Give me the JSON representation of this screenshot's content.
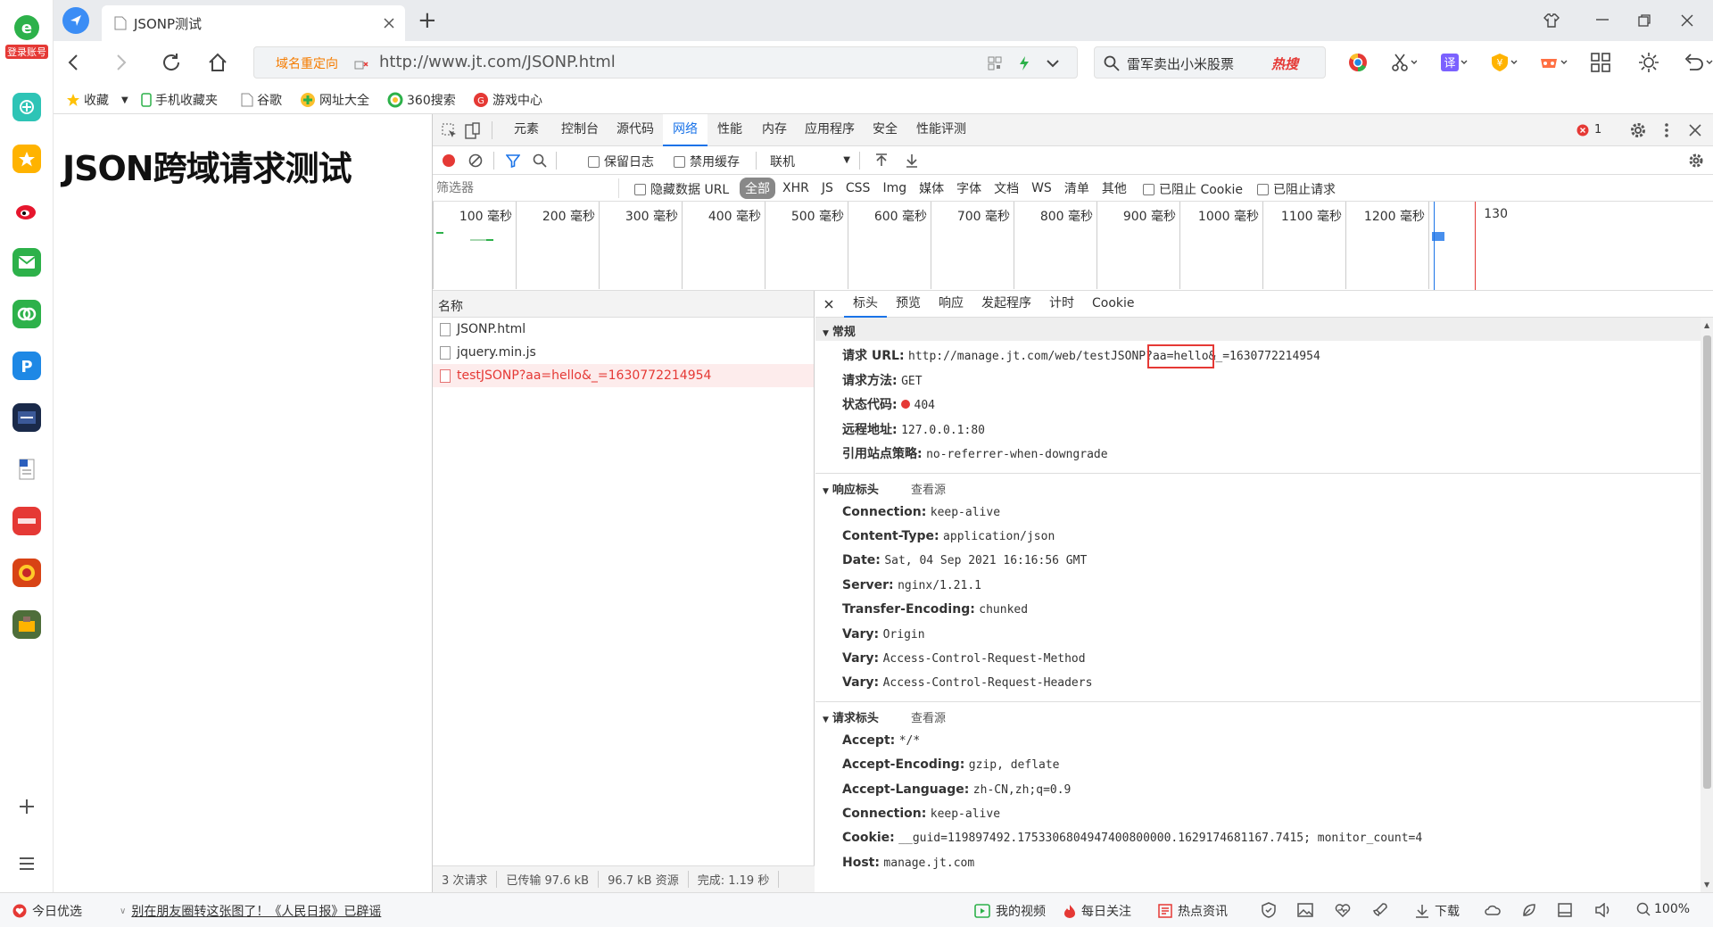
{
  "sidebar": {
    "login_label": "登录账号"
  },
  "tab": {
    "title": "JSONP测试",
    "new_tab": "+"
  },
  "address": {
    "redirect_label": "域名重定向",
    "url": "http://www.jt.com/JSONP.html",
    "search_text": "雷军卖出小米股票",
    "hot_label": "热搜"
  },
  "bookmarks": [
    {
      "label": "收藏"
    },
    {
      "label": "手机收藏夹"
    },
    {
      "label": "谷歌"
    },
    {
      "label": "网址大全"
    },
    {
      "label": "360搜索"
    },
    {
      "label": "游戏中心"
    }
  ],
  "page": {
    "heading": "JSON跨域请求测试"
  },
  "devtools": {
    "tabs": [
      "元素",
      "控制台",
      "源代码",
      "网络",
      "性能",
      "内存",
      "应用程序",
      "安全",
      "性能评测"
    ],
    "active_tab": "网络",
    "error_count": "1",
    "toolbar": {
      "preserve_log": "保留日志",
      "disable_cache": "禁用缓存",
      "throttle": "联机"
    },
    "filter": {
      "placeholder": "筛选器",
      "hide_data_url": "隐藏数据 URL",
      "types": [
        "全部",
        "XHR",
        "JS",
        "CSS",
        "Img",
        "媒体",
        "字体",
        "文档",
        "WS",
        "清单",
        "其他"
      ],
      "blocked_cookies": "已阻止 Cookie",
      "blocked_requests": "已阻止请求"
    },
    "timeline_ticks": [
      "100 毫秒",
      "200 毫秒",
      "300 毫秒",
      "400 毫秒",
      "500 毫秒",
      "600 毫秒",
      "700 毫秒",
      "800 毫秒",
      "900 毫秒",
      "1000 毫秒",
      "1100 毫秒",
      "1200 毫秒",
      "130"
    ],
    "requests_header": "名称",
    "requests": [
      {
        "name": "JSONP.html",
        "error": false
      },
      {
        "name": "jquery.min.js",
        "error": false
      },
      {
        "name": "testJSONP?aa=hello&_=1630772214954",
        "error": true
      }
    ],
    "summary": {
      "requests": "3 次请求",
      "transferred": "已传输 97.6 kB",
      "resources": "96.7 kB 资源",
      "finish": "完成: 1.19 秒"
    },
    "detail_tabs": [
      "标头",
      "预览",
      "响应",
      "发起程序",
      "计时",
      "Cookie"
    ],
    "general": {
      "title": "常规",
      "url_label": "请求 URL:",
      "url_pre": "http://manage.jt.com/web/testJSONP?",
      "url_highlight": "aa=hello",
      "url_post": "&_=1630772214954",
      "method_label": "请求方法:",
      "method": "GET",
      "status_label": "状态代码:",
      "status": "404",
      "remote_label": "远程地址:",
      "remote": "127.0.0.1:80",
      "referrer_label": "引用站点策略:",
      "referrer": "no-referrer-when-downgrade"
    },
    "response_headers": {
      "title": "响应标头",
      "view_source": "查看源",
      "items": [
        {
          "k": "Connection:",
          "v": "keep-alive"
        },
        {
          "k": "Content-Type:",
          "v": "application/json"
        },
        {
          "k": "Date:",
          "v": "Sat, 04 Sep 2021 16:16:56 GMT"
        },
        {
          "k": "Server:",
          "v": "nginx/1.21.1"
        },
        {
          "k": "Transfer-Encoding:",
          "v": "chunked"
        },
        {
          "k": "Vary:",
          "v": "Origin"
        },
        {
          "k": "Vary:",
          "v": "Access-Control-Request-Method"
        },
        {
          "k": "Vary:",
          "v": "Access-Control-Request-Headers"
        }
      ]
    },
    "request_headers": {
      "title": "请求标头",
      "view_source": "查看源",
      "items": [
        {
          "k": "Accept:",
          "v": "*/*"
        },
        {
          "k": "Accept-Encoding:",
          "v": "gzip, deflate"
        },
        {
          "k": "Accept-Language:",
          "v": "zh-CN,zh;q=0.9"
        },
        {
          "k": "Connection:",
          "v": "keep-alive"
        },
        {
          "k": "Cookie:",
          "v": "__guid=119897492.1753306804947400800000.1629174681167.7415; monitor_count=4"
        },
        {
          "k": "Host:",
          "v": "manage.jt.com"
        }
      ]
    }
  },
  "statusbar": {
    "today": "今日优选",
    "news": "别在朋友圈转这张图了！《人民日报》已辟谣",
    "my_video": "我的视频",
    "daily": "每日关注",
    "hot_news": "热点资讯",
    "download": "下载",
    "zoom": "100%"
  },
  "colors": {
    "accent": "#1a73e8",
    "error": "#e53935",
    "highlight_box": "#e53935"
  }
}
